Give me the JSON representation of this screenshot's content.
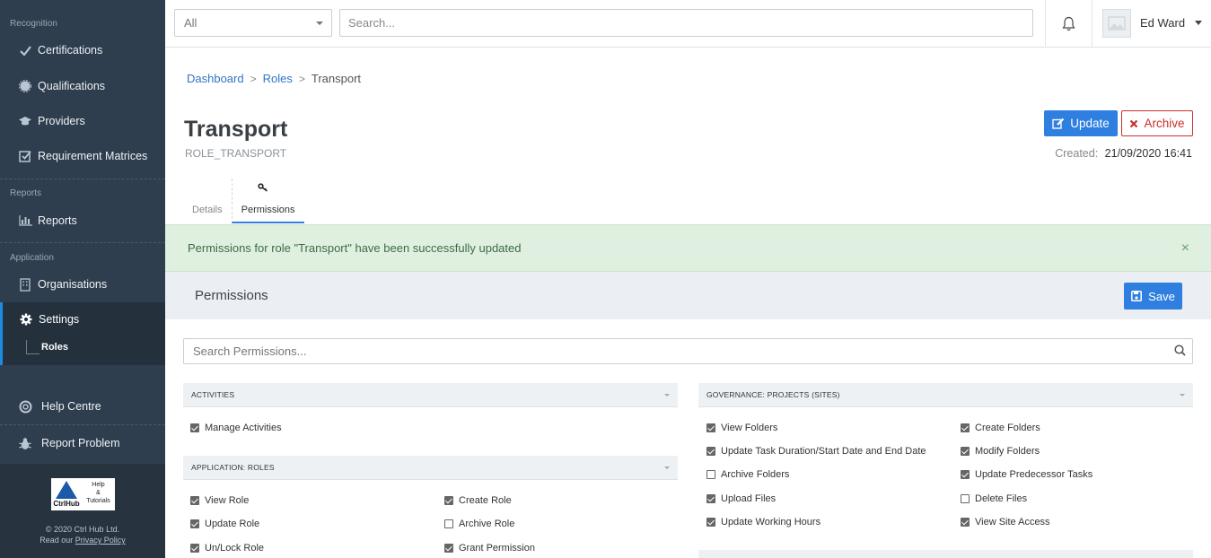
{
  "sidebar": {
    "sections": {
      "recognition": "Recognition",
      "reports": "Reports",
      "application": "Application"
    },
    "items": {
      "certifications": "Certifications",
      "qualifications": "Qualifications",
      "providers": "Providers",
      "requirement_matrices": "Requirement Matrices",
      "reports": "Reports",
      "organisations": "Organisations",
      "settings": "Settings",
      "roles": "Roles",
      "help_centre": "Help Centre",
      "report_problem": "Report Problem"
    },
    "logo": {
      "brand": "CtrlHub",
      "help_line1": "Help",
      "help_line2": "&",
      "help_line3": "Tutorials"
    },
    "copyright": "© 2020 Ctrl Hub Ltd.",
    "privacy_prefix": "Read our",
    "privacy_link": "Privacy Policy"
  },
  "topbar": {
    "filter_value": "All",
    "search_placeholder": "Search...",
    "user_name": "Ed Ward"
  },
  "breadcrumb": {
    "dashboard": "Dashboard",
    "roles": "Roles",
    "current": "Transport",
    "separator": ">"
  },
  "page": {
    "title": "Transport",
    "subtitle": "ROLE_TRANSPORT",
    "update_label": "Update",
    "archive_label": "Archive",
    "created_label": "Created:",
    "created_value": "21/09/2020 16:41"
  },
  "tabs": {
    "details": "Details",
    "permissions": "Permissions"
  },
  "alert": {
    "message": "Permissions for role \"Transport\" have been successfully updated",
    "close": "×"
  },
  "permissions": {
    "title": "Permissions",
    "save_label": "Save",
    "search_placeholder": "Search Permissions...",
    "groups": {
      "activities": {
        "title": "ACTIVITIES",
        "items": [
          {
            "label": "Manage Activities",
            "checked": true
          }
        ]
      },
      "app_roles": {
        "title": "APPLICATION: ROLES",
        "items": [
          {
            "label": "View Role",
            "checked": true
          },
          {
            "label": "Create Role",
            "checked": true
          },
          {
            "label": "Update Role",
            "checked": true
          },
          {
            "label": "Archive Role",
            "checked": false
          },
          {
            "label": "Un/Lock Role",
            "checked": true
          },
          {
            "label": "Grant Permission",
            "checked": true
          }
        ]
      },
      "gov_projects": {
        "title": "GOVERNANCE: PROJECTS (SITES)",
        "items": [
          {
            "label": "View Folders",
            "checked": true
          },
          {
            "label": "Create Folders",
            "checked": true
          },
          {
            "label": "Update Task Duration/Start Date and End Date",
            "checked": true
          },
          {
            "label": "Modify Folders",
            "checked": true
          },
          {
            "label": "Archive Folders",
            "checked": false
          },
          {
            "label": "Update Predecessor Tasks",
            "checked": true
          },
          {
            "label": "Upload Files",
            "checked": true
          },
          {
            "label": "Delete Files",
            "checked": false
          },
          {
            "label": "Update Working Hours",
            "checked": true
          },
          {
            "label": "View Site Access",
            "checked": true
          }
        ]
      }
    }
  },
  "colors": {
    "sidebar_bg": "#2f3e4e",
    "primary": "#2e7fe0",
    "danger": "#c9302c",
    "success_bg": "#dff0e1"
  }
}
